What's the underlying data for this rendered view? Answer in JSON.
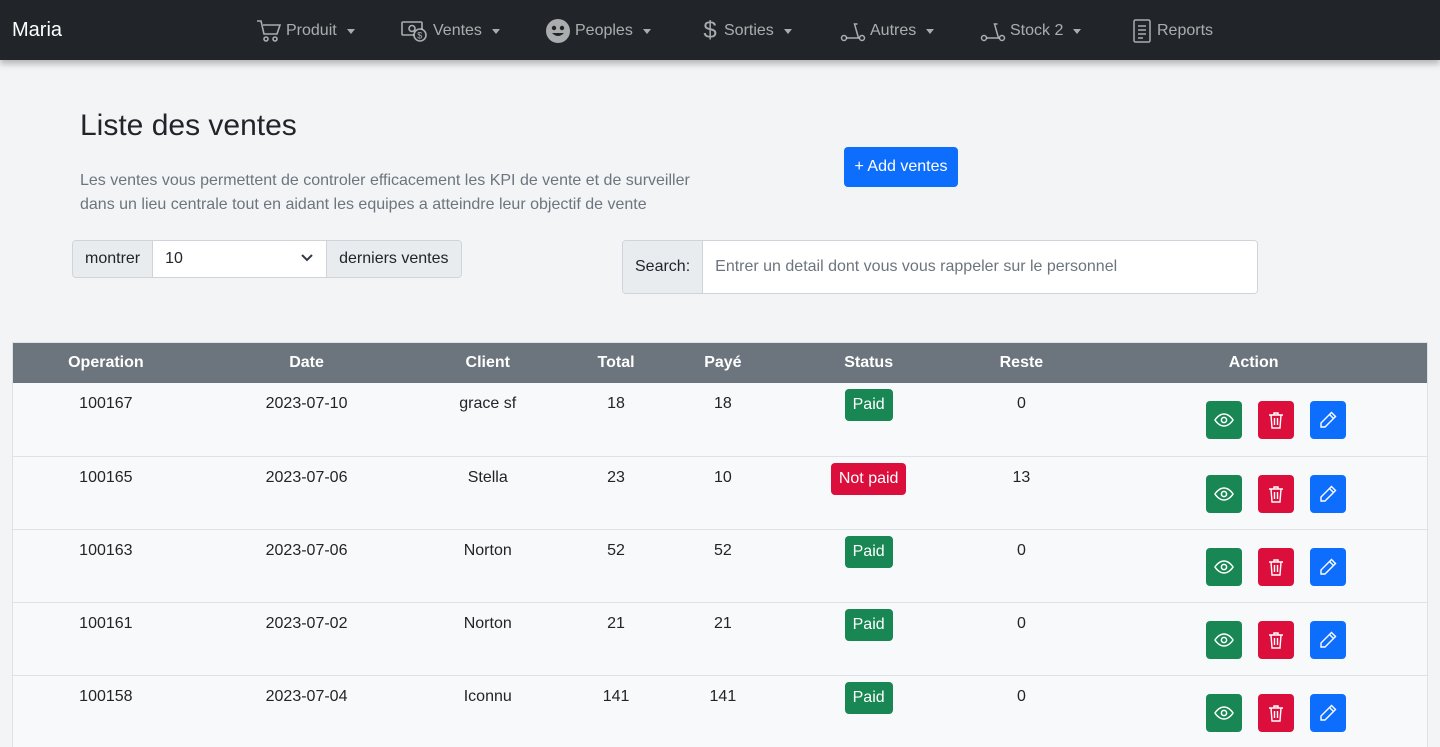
{
  "navbar": {
    "brand": "Maria",
    "items": [
      {
        "label": "Produit",
        "icon": "cart-icon",
        "dropdown": true
      },
      {
        "label": "Ventes",
        "icon": "cash-icon",
        "dropdown": true
      },
      {
        "label": "Peoples",
        "icon": "smiley-icon",
        "dropdown": true
      },
      {
        "label": "Sorties",
        "icon": "dollar-icon",
        "dropdown": true
      },
      {
        "label": "Autres",
        "icon": "scooter-icon",
        "dropdown": true
      },
      {
        "label": "Stock 2",
        "icon": "scooter-icon",
        "dropdown": true
      },
      {
        "label": "Reports",
        "icon": "document-icon",
        "dropdown": false
      }
    ]
  },
  "header": {
    "title": "Liste des ventes",
    "description_line1": "Les ventes vous permettent de controler efficacement les KPI de vente et de surveiller",
    "description_line2": "dans un lieu centrale tout en aidant les equipes a atteindre leur objectif de vente",
    "add_button": "+ Add ventes"
  },
  "show": {
    "prefix": "montrer",
    "selected": "10",
    "suffix": "derniers ventes"
  },
  "search": {
    "label": "Search:",
    "placeholder": "Entrer un detail dont vous vous rappeler sur le personnel"
  },
  "table": {
    "columns": [
      "Operation",
      "Date",
      "Client",
      "Total",
      "Payé",
      "Status",
      "Reste",
      "Action"
    ],
    "rows": [
      {
        "operation": "100167",
        "date": "2023-07-10",
        "client": "grace sf",
        "total": "18",
        "paye": "18",
        "status": "Paid",
        "reste": "0"
      },
      {
        "operation": "100165",
        "date": "2023-07-06",
        "client": "Stella",
        "total": "23",
        "paye": "10",
        "status": "Not paid",
        "reste": "13"
      },
      {
        "operation": "100163",
        "date": "2023-07-06",
        "client": "Norton",
        "total": "52",
        "paye": "52",
        "status": "Paid",
        "reste": "0"
      },
      {
        "operation": "100161",
        "date": "2023-07-02",
        "client": "Norton",
        "total": "21",
        "paye": "21",
        "status": "Paid",
        "reste": "0"
      },
      {
        "operation": "100158",
        "date": "2023-07-04",
        "client": "Iconnu",
        "total": "141",
        "paye": "141",
        "status": "Paid",
        "reste": "0"
      }
    ]
  },
  "colors": {
    "navbar": "#212529",
    "primary": "#0d6efd",
    "success": "#198754",
    "danger": "#dc0e3c",
    "table_header": "#6c757d"
  }
}
